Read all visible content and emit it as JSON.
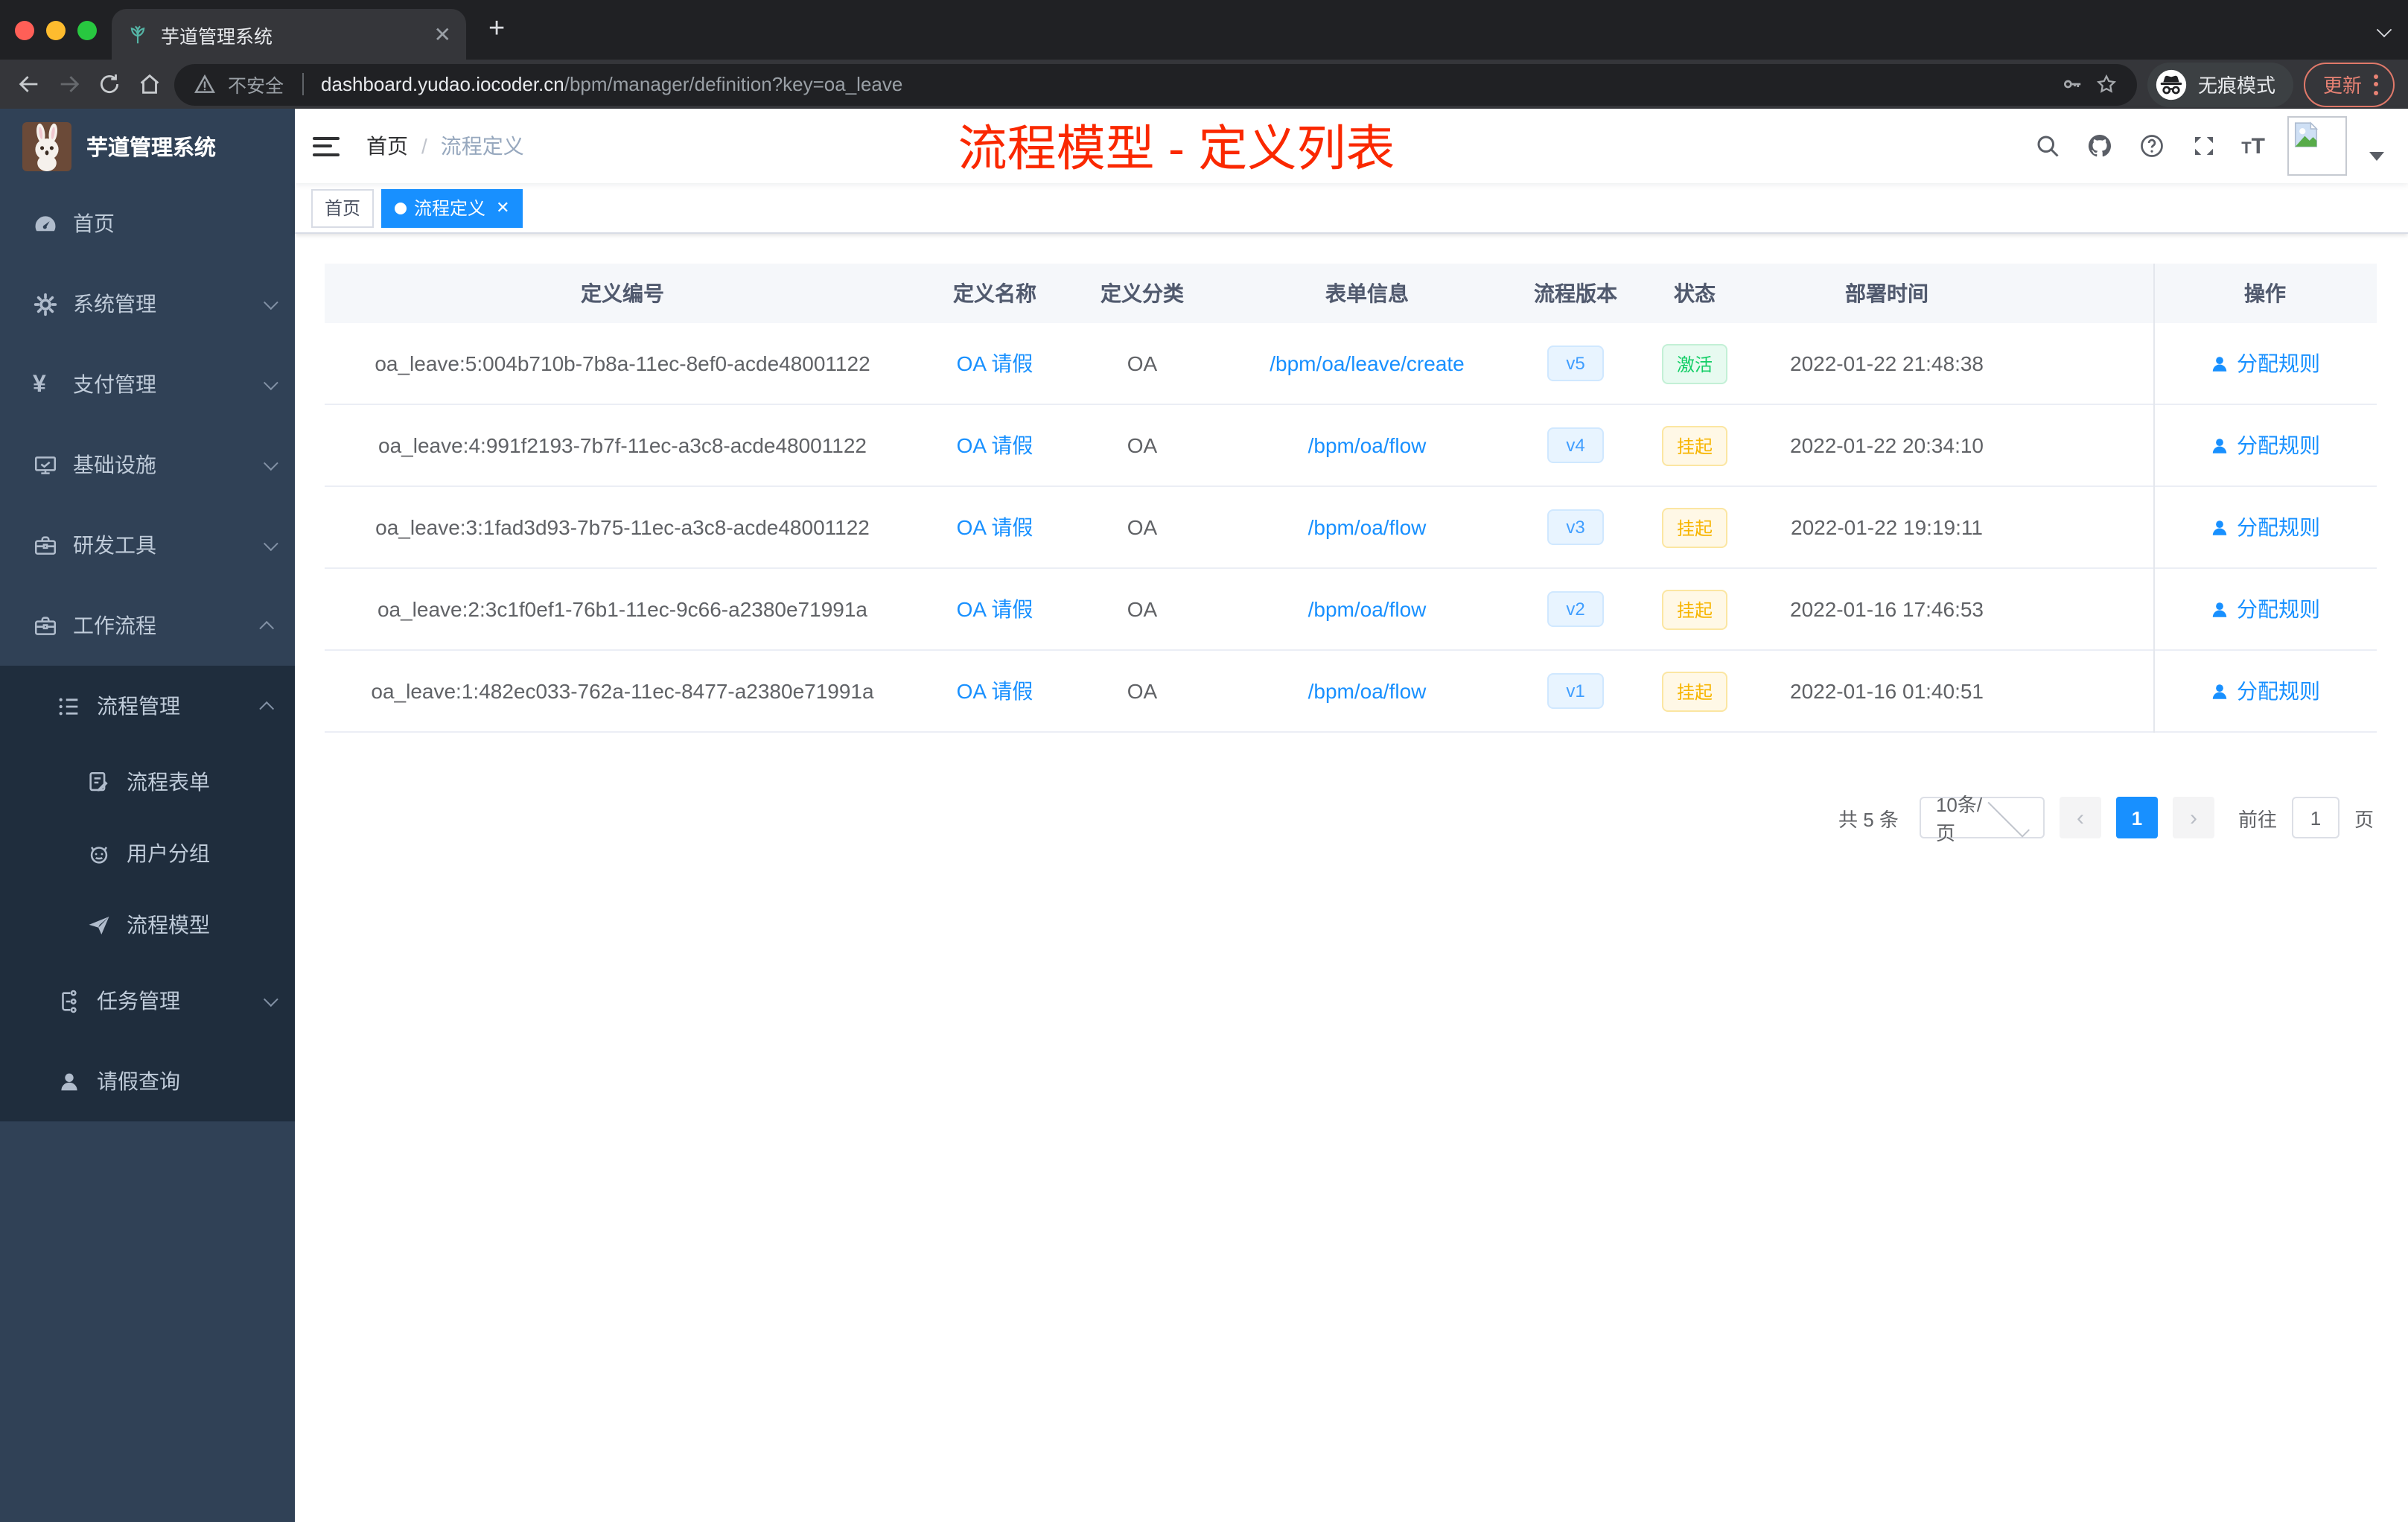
{
  "colors": {
    "accent": "#1890ff",
    "annotation_red": "#fa2800",
    "success": "#13ce66",
    "warning": "#f7b500",
    "sidebar_bg": "#304156",
    "submenu_bg": "#1f2d3d",
    "tab_bg": "#35363a"
  },
  "browser": {
    "tab_title": "芋道管理系统",
    "security_label": "不安全",
    "url_host": "dashboard.yudao.iocoder.cn",
    "url_path": "/bpm/manager/definition?key=oa_leave",
    "incognito_label": "无痕模式",
    "update_label": "更新"
  },
  "sidebar": {
    "app_title": "芋道管理系统",
    "items": [
      {
        "label": "首页"
      },
      {
        "label": "系统管理"
      },
      {
        "label": "支付管理"
      },
      {
        "label": "基础设施"
      },
      {
        "label": "研发工具"
      },
      {
        "label": "工作流程",
        "children": [
          {
            "label": "流程管理",
            "children": [
              {
                "label": "流程表单"
              },
              {
                "label": "用户分组"
              },
              {
                "label": "流程模型"
              }
            ]
          },
          {
            "label": "任务管理"
          },
          {
            "label": "请假查询"
          }
        ]
      }
    ]
  },
  "header": {
    "breadcrumb_home": "首页",
    "breadcrumb_current": "流程定义",
    "annotation": "流程模型 - 定义列表"
  },
  "tags": [
    {
      "label": "首页",
      "active": false
    },
    {
      "label": "流程定义",
      "active": true
    }
  ],
  "table": {
    "columns": [
      "定义编号",
      "定义名称",
      "定义分类",
      "表单信息",
      "流程版本",
      "状态",
      "部署时间",
      "操作"
    ],
    "rows": [
      {
        "id": "oa_leave:5:004b710b-7b8a-11ec-8ef0-acde48001122",
        "name": "OA 请假",
        "category": "OA",
        "form": "/bpm/oa/leave/create",
        "version": "v5",
        "status": "激活",
        "status_type": "success",
        "time": "2022-01-22 21:48:38",
        "action": "分配规则"
      },
      {
        "id": "oa_leave:4:991f2193-7b7f-11ec-a3c8-acde48001122",
        "name": "OA 请假",
        "category": "OA",
        "form": "/bpm/oa/flow",
        "version": "v4",
        "status": "挂起",
        "status_type": "warning",
        "time": "2022-01-22 20:34:10",
        "action": "分配规则"
      },
      {
        "id": "oa_leave:3:1fad3d93-7b75-11ec-a3c8-acde48001122",
        "name": "OA 请假",
        "category": "OA",
        "form": "/bpm/oa/flow",
        "version": "v3",
        "status": "挂起",
        "status_type": "warning",
        "time": "2022-01-22 19:19:11",
        "action": "分配规则"
      },
      {
        "id": "oa_leave:2:3c1f0ef1-76b1-11ec-9c66-a2380e71991a",
        "name": "OA 请假",
        "category": "OA",
        "form": "/bpm/oa/flow",
        "version": "v2",
        "status": "挂起",
        "status_type": "warning",
        "time": "2022-01-16 17:46:53",
        "action": "分配规则"
      },
      {
        "id": "oa_leave:1:482ec033-762a-11ec-8477-a2380e71991a",
        "name": "OA 请假",
        "category": "OA",
        "form": "/bpm/oa/flow",
        "version": "v1",
        "status": "挂起",
        "status_type": "warning",
        "time": "2022-01-16 01:40:51",
        "action": "分配规则"
      }
    ]
  },
  "pagination": {
    "total_label": "共 5 条",
    "page_size_label": "10条/页",
    "prev": "‹",
    "current_page": "1",
    "next": "›",
    "goto_label": "前往",
    "goto_value": "1",
    "unit_label": "页"
  }
}
